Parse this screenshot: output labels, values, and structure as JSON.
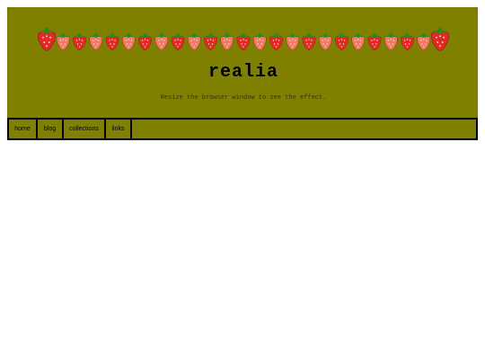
{
  "header": {
    "title": "realia",
    "subtitle": "Resize the browser window to see the effect."
  },
  "nav": {
    "items": [
      {
        "label": "home"
      },
      {
        "label": "blog"
      },
      {
        "label": "collections"
      },
      {
        "label": "links"
      }
    ]
  },
  "decoration": {
    "icon": "strawberry-icon",
    "count": 25,
    "colors": {
      "red": "#e02a2a",
      "pink": "#f07a6a",
      "leaf": "#2c8a1c",
      "header_bg": "#808000"
    }
  }
}
